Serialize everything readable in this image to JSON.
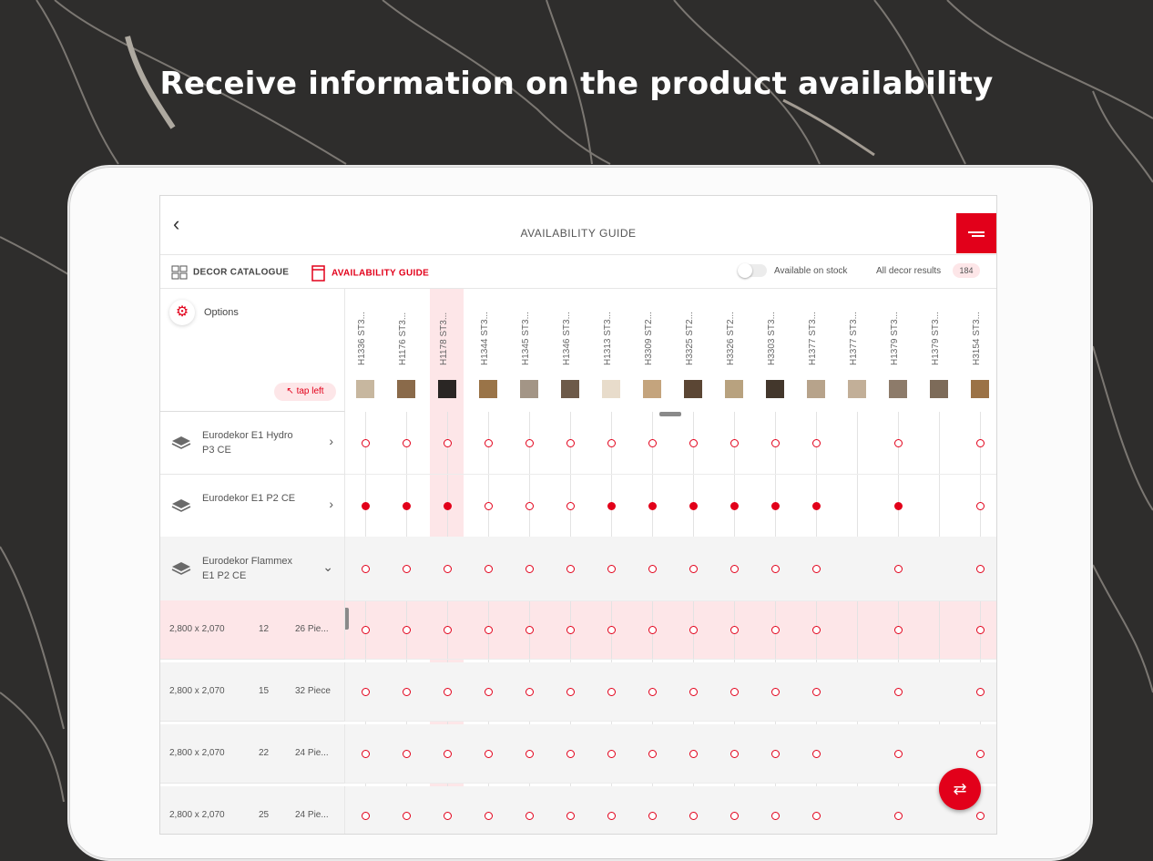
{
  "headline": "Receive information on the product availability",
  "app": {
    "title": "AVAILABILITY GUIDE",
    "back_icon": "chevron-left-icon",
    "menu_icon": "menu-icon"
  },
  "nav": {
    "decor_catalogue": "DECOR CATALOGUE",
    "availability_guide": "AVAILABILITY GUIDE",
    "available_on_stock": "Available on stock",
    "all_decor_results": "All decor results",
    "count": "184",
    "available_on_stock_on": false
  },
  "options": {
    "label": "Options",
    "tap_left": "tap left"
  },
  "columns": [
    {
      "code": "H1336 ST3...",
      "color": "#c7b79f"
    },
    {
      "code": "H1176 ST3...",
      "color": "#8a6a4a"
    },
    {
      "code": "H1178 ST3...",
      "color": "#2a2624"
    },
    {
      "code": "H1344 ST3...",
      "color": "#9a7448"
    },
    {
      "code": "H1345 ST3...",
      "color": "#a39586"
    },
    {
      "code": "H1346 ST3...",
      "color": "#6d5a49"
    },
    {
      "code": "H1313 ST3...",
      "color": "#e8dccb"
    },
    {
      "code": "H3309 ST2...",
      "color": "#c4a47d"
    },
    {
      "code": "H3325 ST2...",
      "color": "#5b4634"
    },
    {
      "code": "H3326 ST2...",
      "color": "#b8a27f"
    },
    {
      "code": "H3303 ST3...",
      "color": "#43372c"
    },
    {
      "code": "H1377 ST3...",
      "color": "#b7a38b"
    },
    {
      "code": "H1377 ST3...",
      "color": "#c2af98"
    },
    {
      "code": "H1379 ST3...",
      "color": "#8d7b6a"
    },
    {
      "code": "H1379 ST3...",
      "color": "#7d6b59"
    },
    {
      "code": "H3154 ST3...",
      "color": "#9b7246"
    }
  ],
  "rows": [
    {
      "name": "Eurodekor E1 Hydro P3 CE",
      "state": "collapsed",
      "chev": "›",
      "dots": [
        "o",
        "o",
        "o",
        "o",
        "o",
        "o",
        "o",
        "o",
        "o",
        "o",
        "o",
        "o",
        "",
        "o",
        "",
        "o"
      ]
    },
    {
      "name": "Eurodekor E1 P2 CE",
      "state": "collapsed",
      "chev": "›",
      "dots": [
        "f",
        "f",
        "f",
        "o",
        "o",
        "o",
        "f",
        "f",
        "f",
        "f",
        "f",
        "f",
        "",
        "f",
        "",
        "o"
      ]
    },
    {
      "name": "Eurodekor Flammex E1 P2 CE",
      "state": "expanded",
      "chev": "⌄",
      "dots": [
        "o",
        "o",
        "o",
        "o",
        "o",
        "o",
        "o",
        "o",
        "o",
        "o",
        "o",
        "o",
        "",
        "o",
        "",
        "o"
      ]
    }
  ],
  "sub_rows": [
    {
      "size": "2,800 x 2,070",
      "thickness": "12",
      "pieces": "26 Pie...",
      "dots": [
        "o",
        "o",
        "o",
        "o",
        "o",
        "o",
        "o",
        "o",
        "o",
        "o",
        "o",
        "o",
        "",
        "o",
        "",
        "o"
      ]
    },
    {
      "size": "2,800 x 2,070",
      "thickness": "15",
      "pieces": "32 Piece",
      "dots": [
        "o",
        "o",
        "o",
        "o",
        "o",
        "o",
        "o",
        "o",
        "o",
        "o",
        "o",
        "o",
        "",
        "o",
        "",
        "o"
      ]
    },
    {
      "size": "2,800 x 2,070",
      "thickness": "22",
      "pieces": "24 Pie...",
      "dots": [
        "o",
        "o",
        "o",
        "o",
        "o",
        "o",
        "o",
        "o",
        "o",
        "o",
        "o",
        "o",
        "",
        "o",
        "",
        "o"
      ]
    },
    {
      "size": "2,800 x 2,070",
      "thickness": "25",
      "pieces": "24 Pie...",
      "dots": [
        "o",
        "o",
        "o",
        "o",
        "o",
        "o",
        "o",
        "o",
        "o",
        "o",
        "o",
        "o",
        "",
        "o",
        "",
        "o"
      ]
    }
  ],
  "colors": {
    "accent": "#e2001a",
    "highlight": "#fde6e8"
  }
}
